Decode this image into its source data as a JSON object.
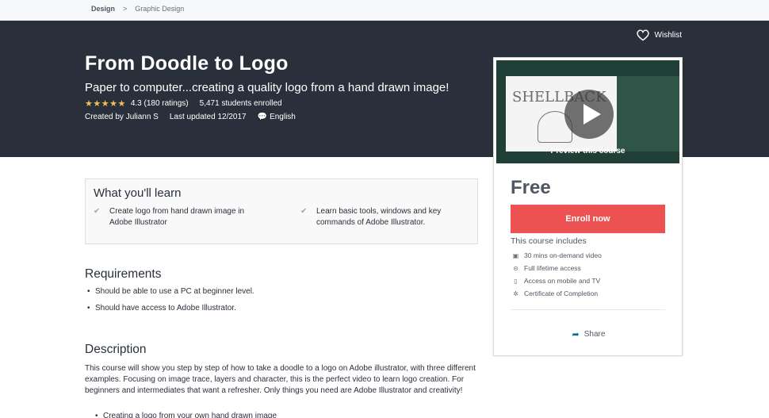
{
  "breadcrumb": {
    "first": "Design",
    "separator": ">",
    "second": "Graphic Design"
  },
  "hero": {
    "title": "From Doodle to Logo",
    "subtitle": "Paper to computer...creating a quality logo from a hand drawn image!",
    "stars": "★★★★★",
    "rating": "4.3 (180 ratings)",
    "enrolled": "5,471 students enrolled",
    "created_by": "Created by Juliann S",
    "updated": "Last updated 12/2017",
    "language": "English",
    "wishlist": "Wishlist"
  },
  "sidebar": {
    "preview_caption": "Preview this course",
    "preview_sheet_text": "SHELLBACK",
    "price": "Free",
    "enroll": "Enroll now",
    "includes_title": "This course includes",
    "includes": [
      {
        "icon": "video-icon",
        "glyph": "▣",
        "text": "30 mins on-demand video"
      },
      {
        "icon": "infinity-icon",
        "glyph": "⊝",
        "text": "Full lifetime access"
      },
      {
        "icon": "mobile-icon",
        "glyph": "▯",
        "text": "Access on mobile and TV"
      },
      {
        "icon": "certificate-icon",
        "glyph": "✲",
        "text": "Certificate of Completion"
      }
    ],
    "share": "Share"
  },
  "learn": {
    "title": "What you'll learn",
    "items": [
      "Create logo from hand drawn image in Adobe Illustrator",
      "Learn basic tools, windows and key commands of Adobe Illustrator."
    ]
  },
  "requirements": {
    "title": "Requirements",
    "items": [
      "Should be able to use a PC at beginner level.",
      "Should have access to Adobe Illustrator."
    ]
  },
  "description": {
    "title": "Description",
    "text": "This course will show you step by step of how to take a doodle to a logo on Adobe illustrator, with three different examples. Focusing on image trace, layers and character, this is the perfect video to learn logo creation. For beginners and intermediates that want a refresher. Only things you need are Adobe Illustrator and creativity!",
    "bullet": "Creating a logo from your own hand drawn image"
  }
}
